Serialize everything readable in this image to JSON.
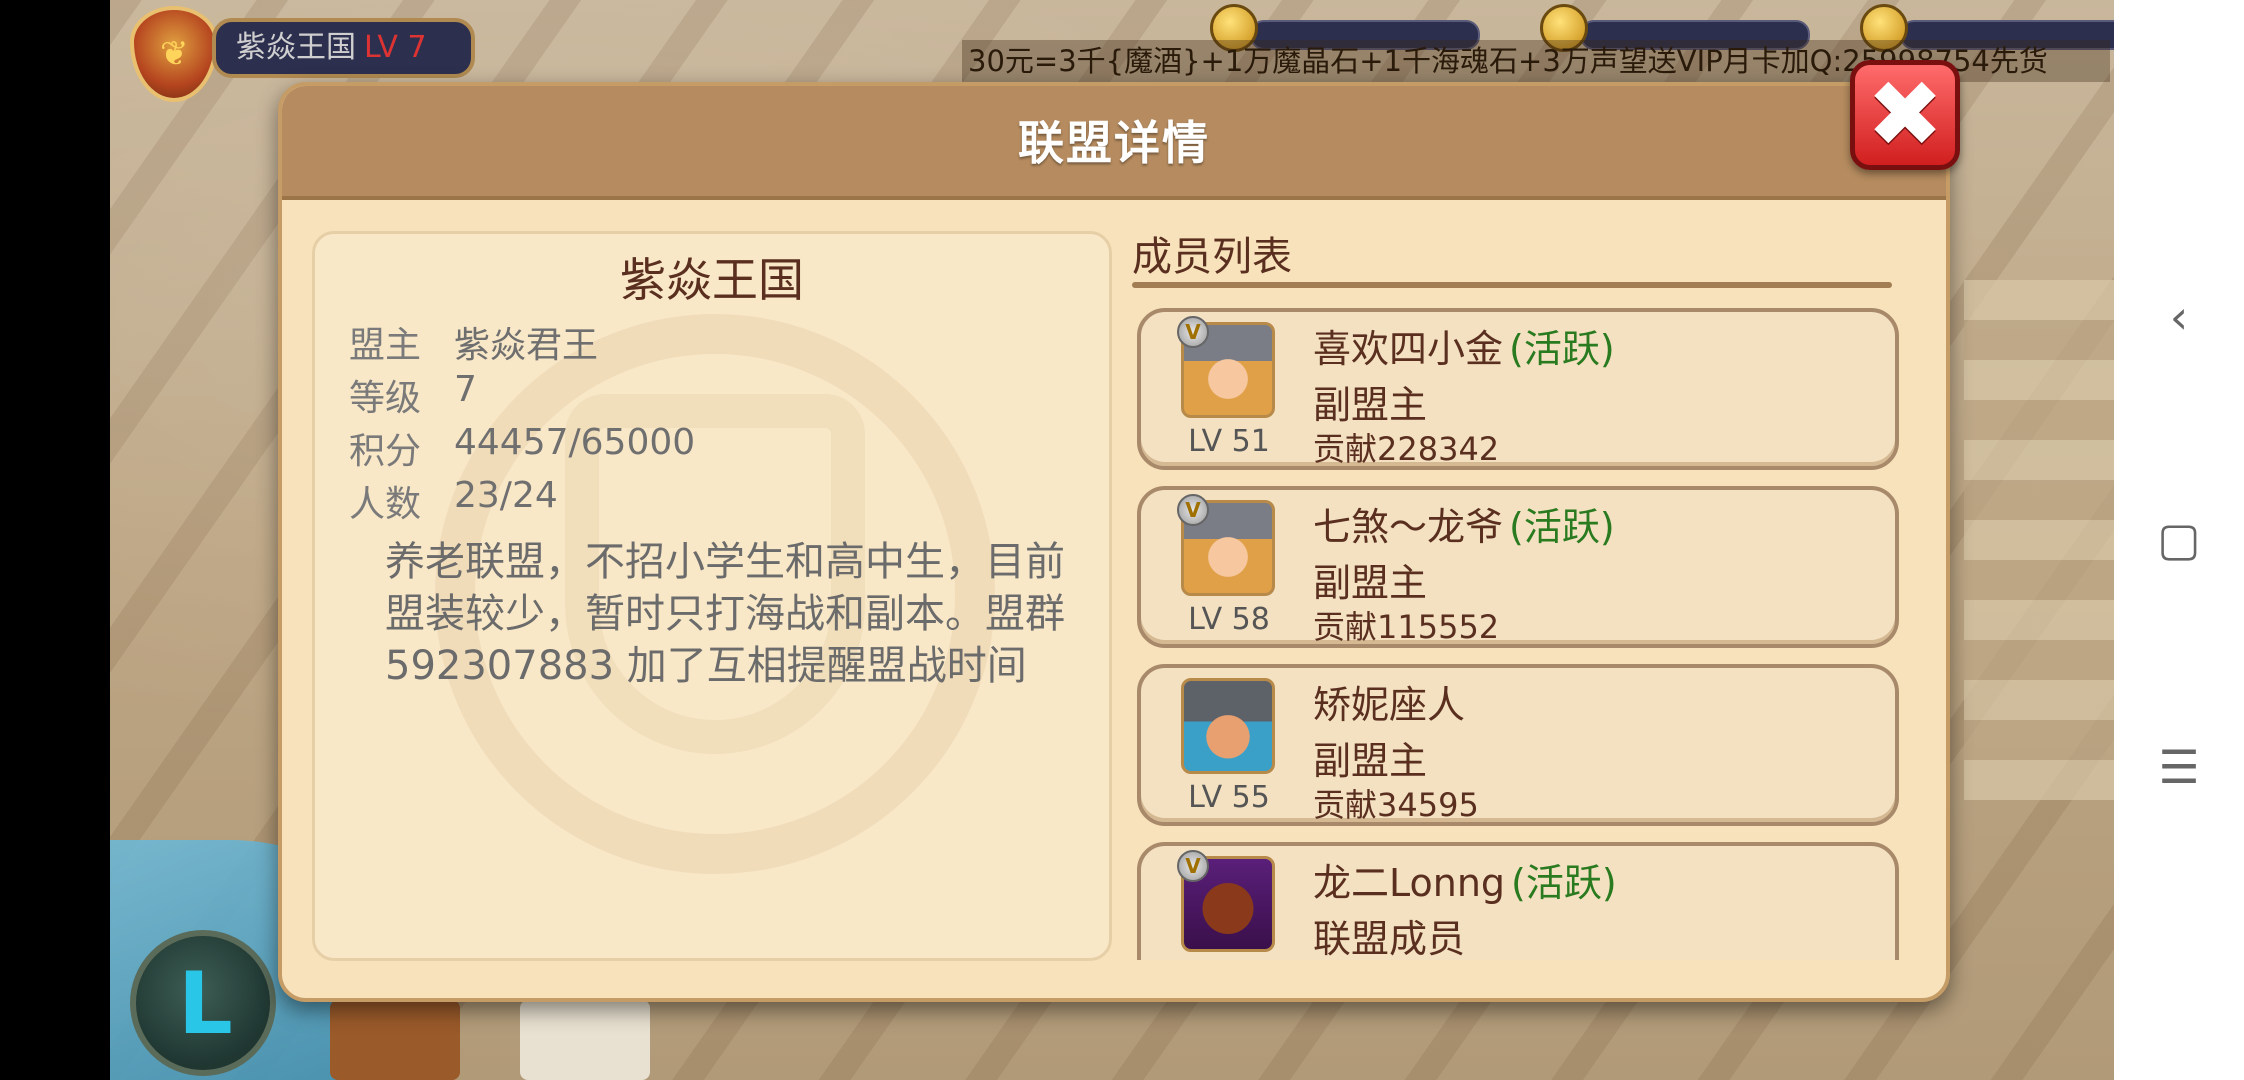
{
  "hud": {
    "kingdom_name": "紫焱王国",
    "kingdom_level": "LV 7",
    "marquee": "30元=3千{魔酒}+1万魔晶石+1千海魂石+3万声望送VIP月卡加Q:25998754先货"
  },
  "dialog": {
    "title": "联盟详情",
    "close_label": "✖"
  },
  "guild": {
    "name": "紫焱王国",
    "rows": [
      {
        "label": "盟主",
        "value": "紫焱君王"
      },
      {
        "label": "等级",
        "value": "7"
      },
      {
        "label": "积分",
        "value": "44457/65000"
      },
      {
        "label": "人数",
        "value": "23/24"
      }
    ],
    "description": "养老联盟，不招小学生和高中生，目前盟装较少，暂时只打海战和副本。盟群592307883 加了互相提醒盟战时间"
  },
  "members": {
    "title": "成员列表",
    "items": [
      {
        "name": "喜欢四小金",
        "status": "(活跃)",
        "role": "副盟主",
        "contribution": "贡献228342",
        "level": "LV 51",
        "vip": "V",
        "avatar": "female-knight-avatar"
      },
      {
        "name": "七煞～龙爷",
        "status": "(活跃)",
        "role": "副盟主",
        "contribution": "贡献115552",
        "level": "LV 58",
        "vip": "V",
        "avatar": "female-knight-avatar"
      },
      {
        "name": "矫妮座人",
        "status": "",
        "role": "副盟主",
        "contribution": "贡献34595",
        "level": "LV 55",
        "vip": "",
        "avatar": "dwarf-warrior-avatar"
      },
      {
        "name": "龙二Lonng",
        "status": "(活跃)",
        "role": "联盟成员",
        "contribution": "",
        "level": "",
        "vip": "V",
        "avatar": "beast-avatar"
      }
    ]
  },
  "navbar": {
    "back": "‹",
    "home": "▢",
    "menu": "☰"
  },
  "icons": {
    "back_button": "L",
    "kingdom_emblem": "wheat-shield-icon"
  }
}
